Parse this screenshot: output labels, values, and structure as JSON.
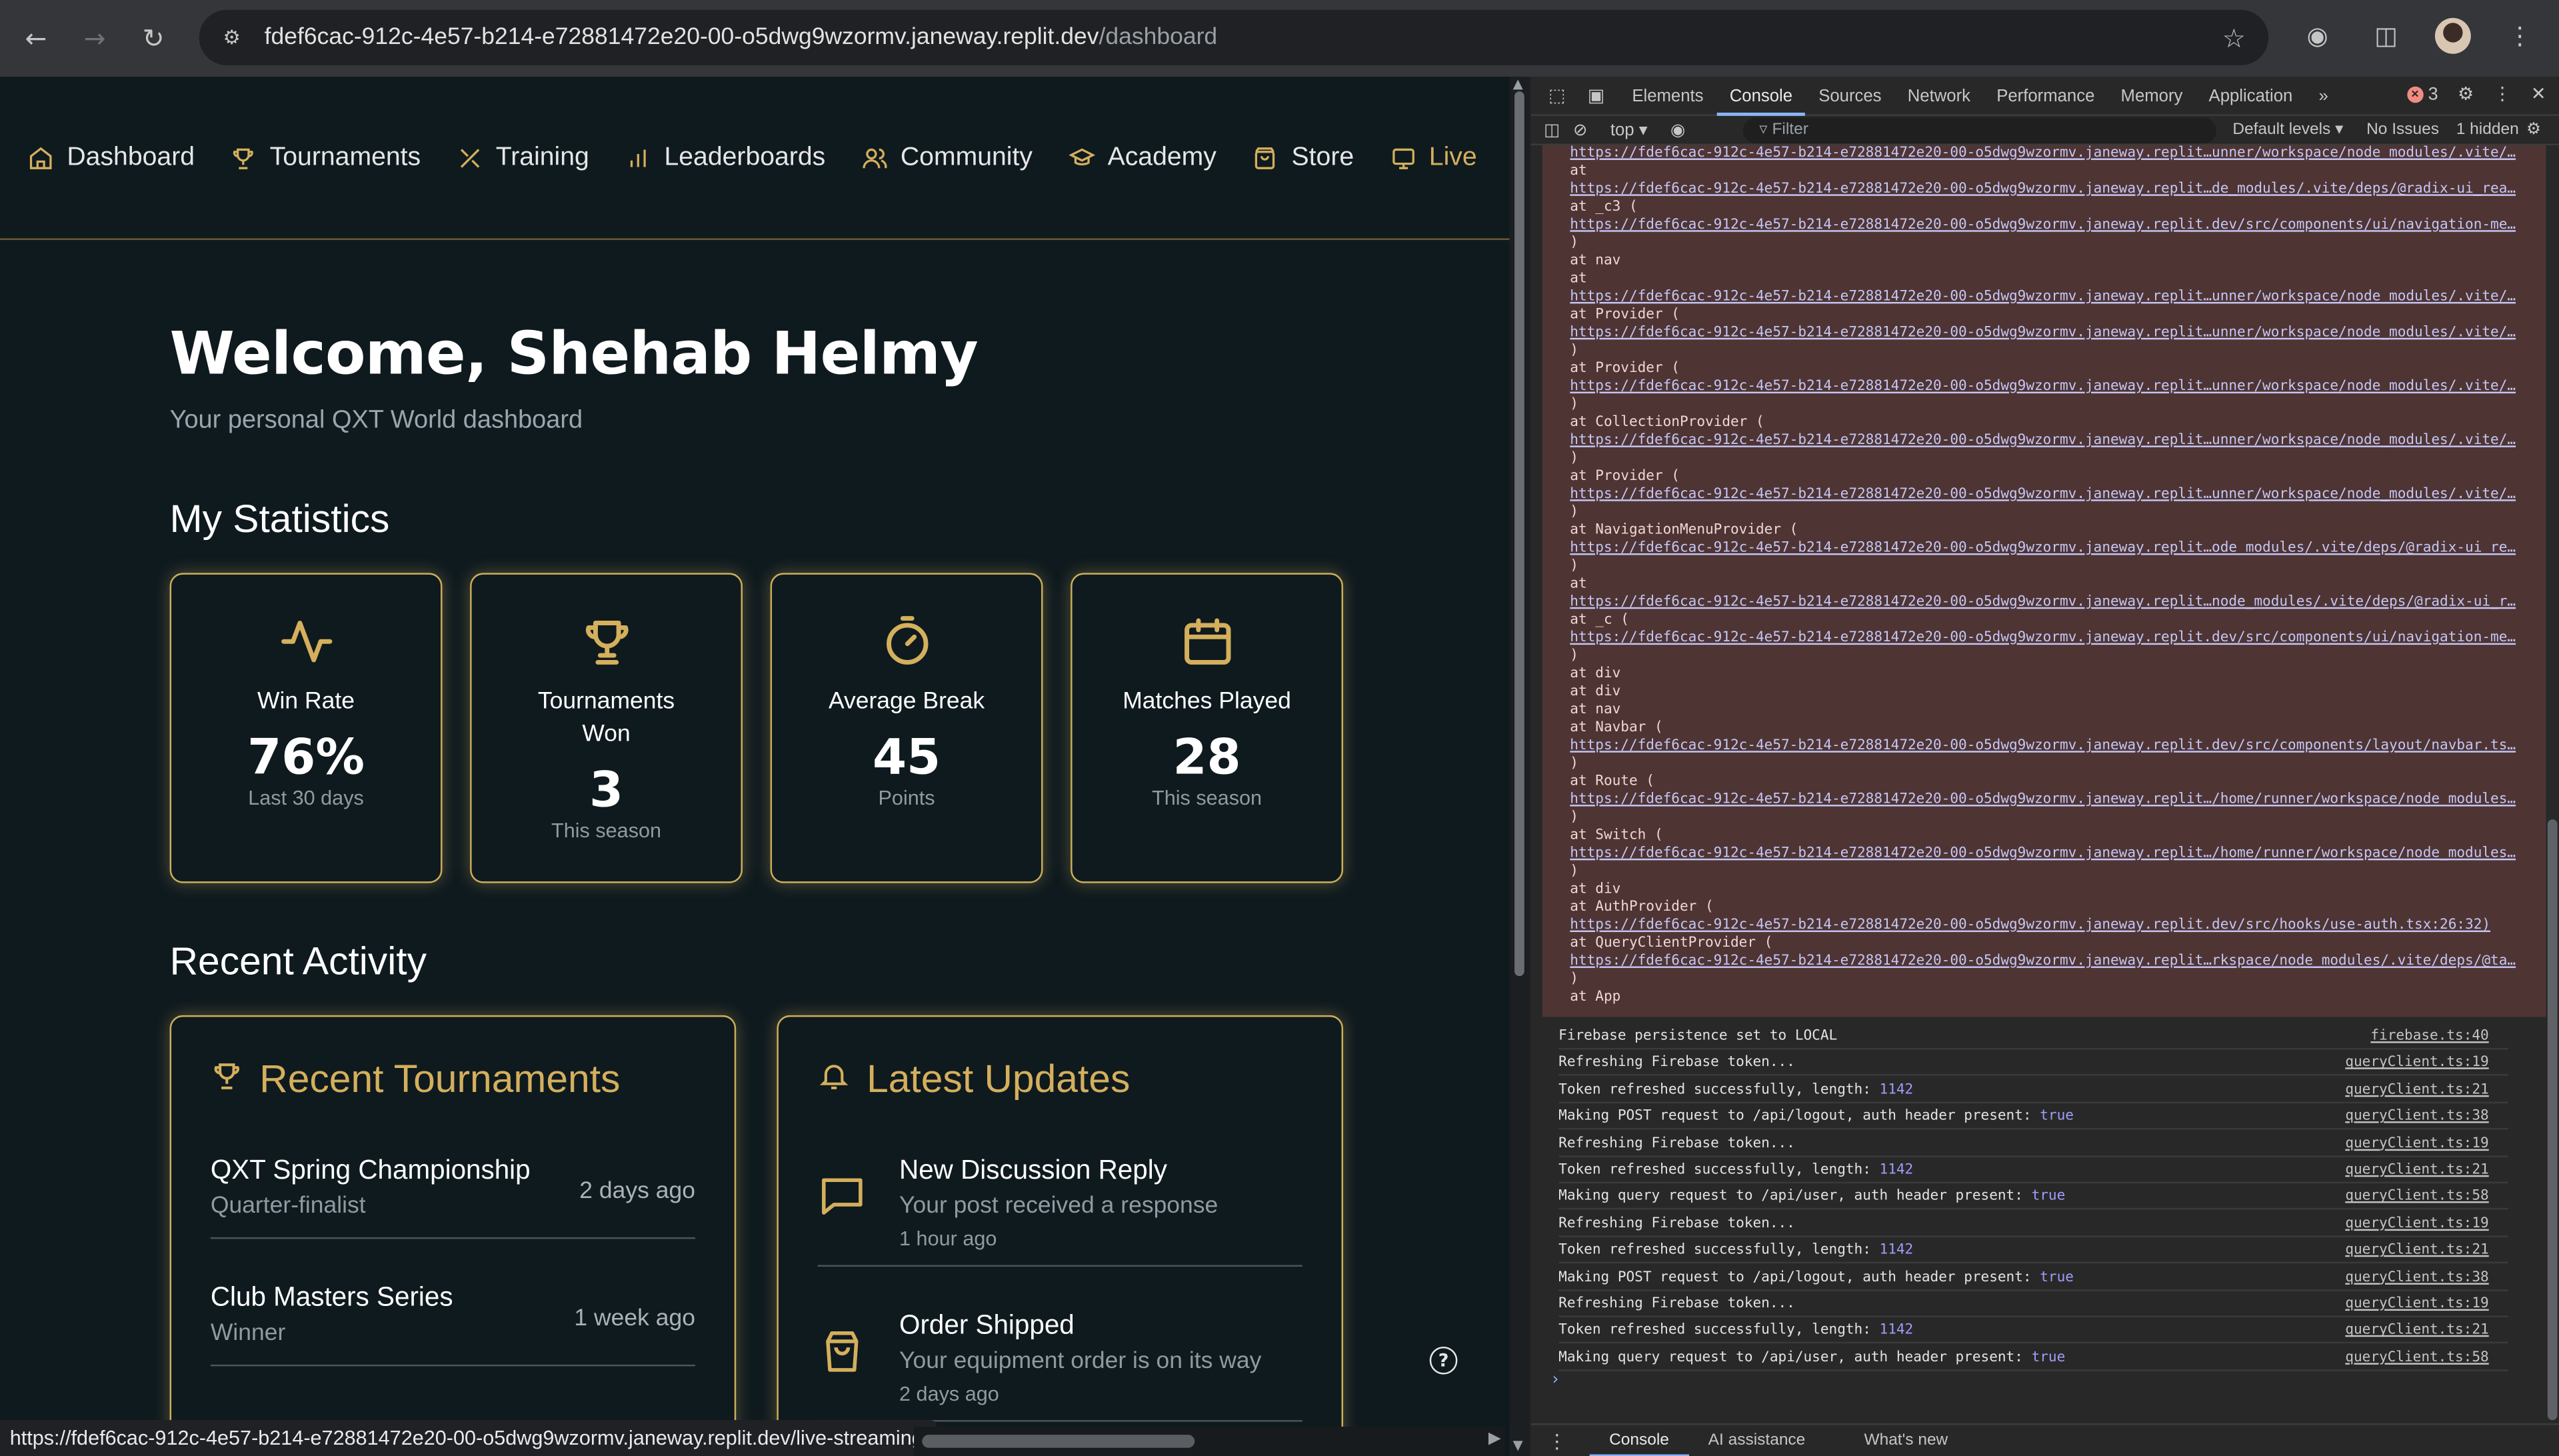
{
  "browser": {
    "url_host": "fdef6cac-912c-4e57-b214-e72881472e20-00-o5dwg9wzormv.janeway.replit.dev",
    "url_path": "/dashboard",
    "status_url": "https://fdef6cac-912c-4e57-b214-e72881472e20-00-o5dwg9wzormv.janeway.replit.dev/live-streaming"
  },
  "site": {
    "nav": [
      {
        "label": "Dashboard",
        "icon": "home-icon"
      },
      {
        "label": "Tournaments",
        "icon": "trophy-icon"
      },
      {
        "label": "Training",
        "icon": "training-icon"
      },
      {
        "label": "Leaderboards",
        "icon": "bar-chart-icon"
      },
      {
        "label": "Community",
        "icon": "users-icon"
      },
      {
        "label": "Academy",
        "icon": "graduation-cap-icon"
      },
      {
        "label": "Store",
        "icon": "shopping-bag-icon"
      },
      {
        "label": "Live",
        "icon": "tv-icon"
      }
    ],
    "welcome": "Welcome, Shehab Helmy",
    "subtitle": "Your personal QXT World dashboard",
    "stats_title": "My Statistics",
    "stats": [
      {
        "label": "Win Rate",
        "value": "76%",
        "sub": "Last 30 days",
        "icon": "activity-icon"
      },
      {
        "label": "Tournaments Won",
        "value": "3",
        "sub": "This season",
        "icon": "trophy-icon"
      },
      {
        "label": "Average Break",
        "value": "45",
        "sub": "Points",
        "icon": "timer-icon"
      },
      {
        "label": "Matches Played",
        "value": "28",
        "sub": "This season",
        "icon": "calendar-icon"
      }
    ],
    "activity_title": "Recent Activity",
    "recent_tournaments": {
      "title": "Recent Tournaments",
      "items": [
        {
          "name": "QXT Spring Championship",
          "result": "Quarter-finalist",
          "when": "2 days ago"
        },
        {
          "name": "Club Masters Series",
          "result": "Winner",
          "when": "1 week ago"
        }
      ]
    },
    "latest_updates": {
      "title": "Latest Updates",
      "items": [
        {
          "title": "New Discussion Reply",
          "desc": "Your post received a response",
          "when": "1 hour ago",
          "icon": "message-square-icon"
        },
        {
          "title": "Order Shipped",
          "desc": "Your equipment order is on its way",
          "when": "2 days ago",
          "icon": "shopping-bag-icon"
        }
      ]
    }
  },
  "devtools": {
    "tabs": [
      "Elements",
      "Console",
      "Sources",
      "Network",
      "Performance",
      "Memory",
      "Application"
    ],
    "active_tab": "Console",
    "error_count": "3",
    "context": "top",
    "filter_placeholder": "Filter",
    "levels": "Default levels",
    "issues": "No Issues",
    "hidden": "1 hidden",
    "trace": [
      {
        "t": "link",
        "text": "https://fdef6cac-912c-4e57-b214-e72881472e20-00-o5dwg9wzormv.janeway.replit…unner/workspace/node_modules/.vite/…"
      },
      {
        "t": "text",
        "text": "    at"
      },
      {
        "t": "link",
        "text": "https://fdef6cac-912c-4e57-b214-e72881472e20-00-o5dwg9wzormv.janeway.replit…de_modules/.vite/deps/@radix-ui_rea…"
      },
      {
        "t": "text",
        "text": "    at _c3 ("
      },
      {
        "t": "link",
        "text": "https://fdef6cac-912c-4e57-b214-e72881472e20-00-o5dwg9wzormv.janeway.replit.dev/src/components/ui/navigation-me…"
      },
      {
        "t": "text",
        "text": ")"
      },
      {
        "t": "text",
        "text": "    at nav"
      },
      {
        "t": "text",
        "text": "    at"
      },
      {
        "t": "link",
        "text": "https://fdef6cac-912c-4e57-b214-e72881472e20-00-o5dwg9wzormv.janeway.replit…unner/workspace/node_modules/.vite/…"
      },
      {
        "t": "text",
        "text": "    at Provider ("
      },
      {
        "t": "link",
        "text": "https://fdef6cac-912c-4e57-b214-e72881472e20-00-o5dwg9wzormv.janeway.replit…unner/workspace/node_modules/.vite/…"
      },
      {
        "t": "text",
        "text": ")"
      },
      {
        "t": "text",
        "text": "    at Provider ("
      },
      {
        "t": "link",
        "text": "https://fdef6cac-912c-4e57-b214-e72881472e20-00-o5dwg9wzormv.janeway.replit…unner/workspace/node_modules/.vite/…"
      },
      {
        "t": "text",
        "text": ")"
      },
      {
        "t": "text",
        "text": "    at CollectionProvider ("
      },
      {
        "t": "link",
        "text": "https://fdef6cac-912c-4e57-b214-e72881472e20-00-o5dwg9wzormv.janeway.replit…unner/workspace/node_modules/.vite/…"
      },
      {
        "t": "text",
        "text": ")"
      },
      {
        "t": "text",
        "text": "    at Provider ("
      },
      {
        "t": "link",
        "text": "https://fdef6cac-912c-4e57-b214-e72881472e20-00-o5dwg9wzormv.janeway.replit…unner/workspace/node_modules/.vite/…"
      },
      {
        "t": "text",
        "text": ")"
      },
      {
        "t": "text",
        "text": "    at NavigationMenuProvider ("
      },
      {
        "t": "link",
        "text": "https://fdef6cac-912c-4e57-b214-e72881472e20-00-o5dwg9wzormv.janeway.replit…ode_modules/.vite/deps/@radix-ui_re…"
      },
      {
        "t": "text",
        "text": ")"
      },
      {
        "t": "text",
        "text": "    at"
      },
      {
        "t": "link",
        "text": "https://fdef6cac-912c-4e57-b214-e72881472e20-00-o5dwg9wzormv.janeway.replit…node_modules/.vite/deps/@radix-ui_r…"
      },
      {
        "t": "text",
        "text": "    at _c ("
      },
      {
        "t": "link",
        "text": "https://fdef6cac-912c-4e57-b214-e72881472e20-00-o5dwg9wzormv.janeway.replit.dev/src/components/ui/navigation-me…"
      },
      {
        "t": "text",
        "text": ")"
      },
      {
        "t": "text",
        "text": "    at div"
      },
      {
        "t": "text",
        "text": "    at div"
      },
      {
        "t": "text",
        "text": "    at nav"
      },
      {
        "t": "text",
        "text": "    at Navbar ("
      },
      {
        "t": "link",
        "text": "https://fdef6cac-912c-4e57-b214-e72881472e20-00-o5dwg9wzormv.janeway.replit.dev/src/components/layout/navbar.ts…"
      },
      {
        "t": "text",
        "text": ")"
      },
      {
        "t": "text",
        "text": "    at Route ("
      },
      {
        "t": "link",
        "text": "https://fdef6cac-912c-4e57-b214-e72881472e20-00-o5dwg9wzormv.janeway.replit…/home/runner/workspace/node_modules…"
      },
      {
        "t": "text",
        "text": ")"
      },
      {
        "t": "text",
        "text": "    at Switch ("
      },
      {
        "t": "link",
        "text": "https://fdef6cac-912c-4e57-b214-e72881472e20-00-o5dwg9wzormv.janeway.replit…/home/runner/workspace/node_modules…"
      },
      {
        "t": "text",
        "text": ")"
      },
      {
        "t": "text",
        "text": "    at div"
      },
      {
        "t": "text",
        "text": "    at AuthProvider ("
      },
      {
        "t": "link",
        "text": "https://fdef6cac-912c-4e57-b214-e72881472e20-00-o5dwg9wzormv.janeway.replit.dev/src/hooks/use-auth.tsx:26:32)"
      },
      {
        "t": "text",
        "text": "    at QueryClientProvider ("
      },
      {
        "t": "link",
        "text": "https://fdef6cac-912c-4e57-b214-e72881472e20-00-o5dwg9wzormv.janeway.replit…rkspace/node_modules/.vite/deps/@ta…"
      },
      {
        "t": "text",
        "text": ")"
      },
      {
        "t": "text",
        "text": "    at App"
      }
    ],
    "logs": [
      {
        "pre": "Firebase persistence set to LOCAL",
        "hl": "",
        "src": "firebase.ts:40"
      },
      {
        "pre": "Refreshing Firebase token...",
        "hl": "",
        "src": "queryClient.ts:19"
      },
      {
        "pre": "Token refreshed successfully, length: ",
        "hl": "1142",
        "src": "queryClient.ts:21"
      },
      {
        "pre": "Making POST request to /api/logout, auth header present: ",
        "hl": "true",
        "src": "queryClient.ts:38"
      },
      {
        "pre": "Refreshing Firebase token...",
        "hl": "",
        "src": "queryClient.ts:19"
      },
      {
        "pre": "Token refreshed successfully, length: ",
        "hl": "1142",
        "src": "queryClient.ts:21"
      },
      {
        "pre": "Making query request to /api/user, auth header present: ",
        "hl": "true",
        "src": "queryClient.ts:58"
      },
      {
        "pre": "Refreshing Firebase token...",
        "hl": "",
        "src": "queryClient.ts:19"
      },
      {
        "pre": "Token refreshed successfully, length: ",
        "hl": "1142",
        "src": "queryClient.ts:21"
      },
      {
        "pre": "Making POST request to /api/logout, auth header present: ",
        "hl": "true",
        "src": "queryClient.ts:38"
      },
      {
        "pre": "Refreshing Firebase token...",
        "hl": "",
        "src": "queryClient.ts:19"
      },
      {
        "pre": "Token refreshed successfully, length: ",
        "hl": "1142",
        "src": "queryClient.ts:21"
      },
      {
        "pre": "Making query request to /api/user, auth header present: ",
        "hl": "true",
        "src": "queryClient.ts:58"
      }
    ],
    "drawer_tabs": [
      "Console",
      "AI assistance",
      "What's new"
    ]
  }
}
